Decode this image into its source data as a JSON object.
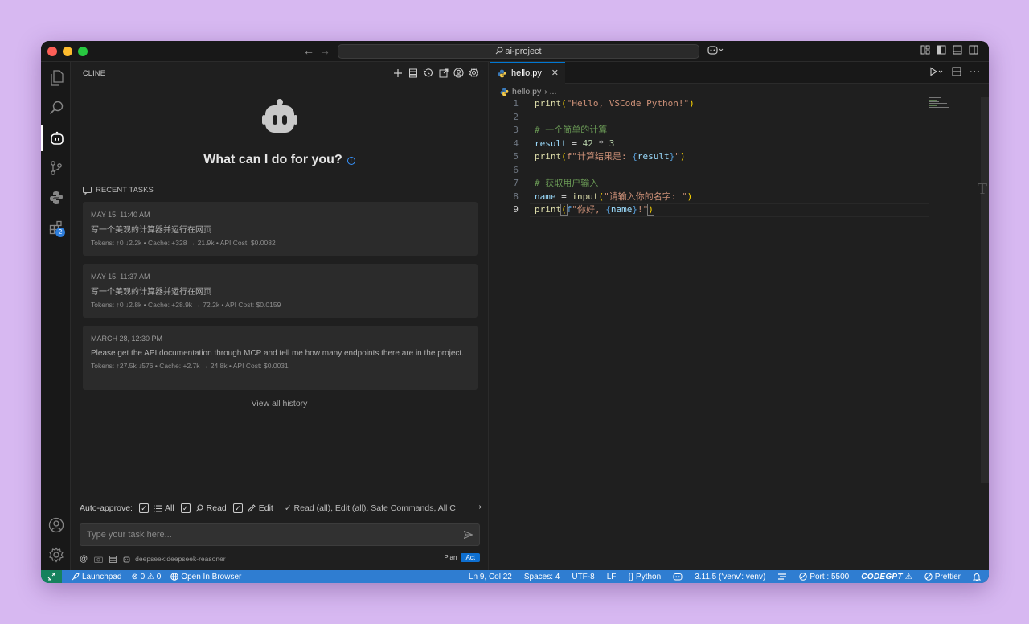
{
  "window": {
    "title": "ai-project"
  },
  "sidebar": {
    "title": "CLINE",
    "tool_icons": [
      "plus-icon",
      "mcp-server-icon",
      "history-icon",
      "popout-icon",
      "account-icon",
      "settings-gear-icon"
    ],
    "hero_text": "What can I do for you?",
    "recent_label": "RECENT TASKS",
    "tasks": [
      {
        "date": "MAY 15, 11:40 AM",
        "text": "写一个美观的计算器并运行在网页",
        "meta": "Tokens: ↑0 ↓2.2k • Cache: +328 → 21.9k • API Cost: $0.0082"
      },
      {
        "date": "MAY 15, 11:37 AM",
        "text": "写一个美观的计算器并运行在网页",
        "meta": "Tokens: ↑0 ↓2.8k • Cache: +28.9k → 72.2k • API Cost: $0.0159"
      },
      {
        "date": "MARCH 28, 12:30 PM",
        "text": "Please get the API documentation through MCP and tell me how many endpoints there are in the project.",
        "meta": "Tokens: ↑27.5k ↓576 • Cache: +2.7k → 24.8k • API Cost: $0.0031"
      }
    ],
    "view_all": "View all history",
    "auto_approve": {
      "label": "Auto-approve:",
      "all": "All",
      "read": "Read",
      "edit": "Edit",
      "summary": "✓ Read (all), Edit (all), Safe Commands, All C"
    },
    "input_placeholder": "Type your task here...",
    "bottom": {
      "at": "@",
      "model": "deepseek:deepseek-reasoner",
      "plan": "Plan",
      "act": "Act"
    }
  },
  "activity_bar": {
    "extensions_badge": "2"
  },
  "editor": {
    "tab": "hello.py",
    "tab_close": "✕",
    "breadcrumb_file": "hello.py",
    "breadcrumb_sep": "› ...",
    "lines": [
      "1",
      "2",
      "3",
      "4",
      "5",
      "6",
      "7",
      "8",
      "9"
    ],
    "code": {
      "l1_fn": "print",
      "l1_str": "\"Hello, VSCode Python!\"",
      "l3_cmt": "# 一个简单的计算",
      "l4_var": "result",
      "l4_op": " = ",
      "l4_num1": "42",
      "l4_mul": " * ",
      "l4_num2": "3",
      "l5_fn": "print",
      "l5_pre": "f\"计算结果是: ",
      "l5_var": "result",
      "l5_end": "\"",
      "l7_cmt": "# 获取用户输入",
      "l8_var": "name",
      "l8_op": " = ",
      "l8_fn": "input",
      "l8_str": "\"请输入你的名字: \"",
      "l9_fn": "print",
      "l9_f": "f",
      "l9_str1": "\"你好, ",
      "l9_var": "name",
      "l9_str2": "!\""
    }
  },
  "statusbar": {
    "launchpad": "Launchpad",
    "problems": "⊗ 0 ⚠ 0",
    "open_browser": "Open In Browser",
    "position": "Ln 9, Col 22",
    "spaces": "Spaces: 4",
    "encoding": "UTF-8",
    "eol": "LF",
    "language": "Python",
    "interpreter": "3.11.5 ('venv': venv)",
    "port": "Port : 5500",
    "codegpt": "CODEGPT",
    "prettier": "Prettier"
  }
}
